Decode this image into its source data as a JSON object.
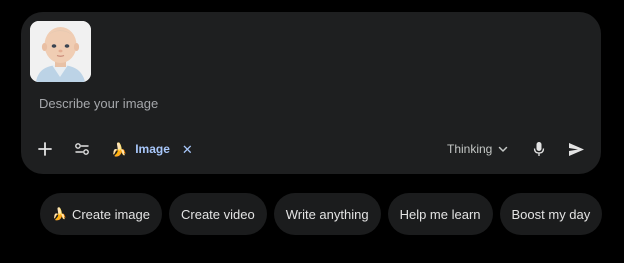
{
  "composer": {
    "attachment": {
      "icon": "baby-photo-thumbnail"
    },
    "placeholder": "Describe your image",
    "toolbar": {
      "add_icon": "plus-icon",
      "tools_icon": "tune-sliders-icon",
      "active_tool": {
        "emoji": "🍌",
        "label": "Image",
        "remove": "✕"
      },
      "mode": {
        "label": "Thinking",
        "icon": "chevron-down-icon"
      },
      "mic_icon": "mic-icon",
      "send_icon": "send-icon"
    }
  },
  "suggestions": [
    {
      "emoji": "🍌",
      "label": "Create image"
    },
    {
      "emoji": "",
      "label": "Create video"
    },
    {
      "emoji": "",
      "label": "Write anything"
    },
    {
      "emoji": "",
      "label": "Help me learn"
    },
    {
      "emoji": "",
      "label": "Boost my day"
    }
  ],
  "colors": {
    "background": "#000000",
    "composer": "#1e1f20",
    "pill": "#1b1c1d",
    "accent": "#a8c7fa",
    "text": "#e3e3e3",
    "muted": "#a5a7ab"
  }
}
